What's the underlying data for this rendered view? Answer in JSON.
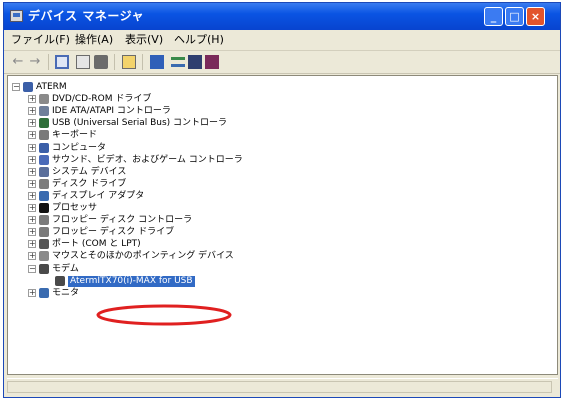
{
  "window": {
    "title": "デバイス マネージャ"
  },
  "menu": [
    "ファイル(F)",
    "操作(A)",
    "表示(V)",
    "ヘルプ(H)"
  ],
  "toolbar_icons": [
    "back-arrow-icon",
    "forward-arrow-icon",
    "properties-icon",
    "scan-hardware-icon",
    "print-icon",
    "help-icon",
    "show-hidden-icon",
    "update-driver-icon",
    "disable-device-icon",
    "uninstall-device-icon"
  ],
  "tree": {
    "root": "ATERM",
    "categories": [
      {
        "label": "DVD/CD-ROM ドライブ",
        "icon": "dvd-drive-icon",
        "color": "#8a8a8a"
      },
      {
        "label": "IDE ATA/ATAPI コントローラ",
        "icon": "ide-controller-icon",
        "color": "#6f7f9a"
      },
      {
        "label": "USB (Universal Serial Bus) コントローラ",
        "icon": "usb-controller-icon",
        "color": "#2f6f3a"
      },
      {
        "label": "キーボード",
        "icon": "keyboard-icon",
        "color": "#7a7a7a"
      },
      {
        "label": "コンピュータ",
        "icon": "computer-icon",
        "color": "#3b5fa8"
      },
      {
        "label": "サウンド、ビデオ、およびゲーム コントローラ",
        "icon": "sound-icon",
        "color": "#4a6ab8"
      },
      {
        "label": "システム デバイス",
        "icon": "system-device-icon",
        "color": "#5a6e9a"
      },
      {
        "label": "ディスク ドライブ",
        "icon": "disk-drive-icon",
        "color": "#7c7c7c"
      },
      {
        "label": "ディスプレイ アダプタ",
        "icon": "display-adapter-icon",
        "color": "#3a6bb0"
      },
      {
        "label": "プロセッサ",
        "icon": "processor-icon",
        "color": "#111111"
      },
      {
        "label": "フロッピー ディスク コントローラ",
        "icon": "floppy-controller-icon",
        "color": "#7a7a7a"
      },
      {
        "label": "フロッピー ディスク ドライブ",
        "icon": "floppy-drive-icon",
        "color": "#7a7a7a"
      },
      {
        "label": "ポート (COM と LPT)",
        "icon": "port-icon",
        "color": "#555555"
      },
      {
        "label": "マウスとそのほかのポインティング デバイス",
        "icon": "mouse-icon",
        "color": "#8a8a8a"
      },
      {
        "label": "モデム",
        "icon": "modem-icon",
        "color": "#4a4a4a",
        "expanded": true,
        "children": [
          {
            "label": "AtermITX70(i)-MAX for USB",
            "icon": "modem-device-icon",
            "selected": true
          }
        ]
      },
      {
        "label": "モニタ",
        "icon": "monitor-icon",
        "color": "#3a6bb0"
      }
    ]
  },
  "colors": {
    "title_bar": "#0a54e3",
    "selection": "#316ac5",
    "highlight_circle": "#e02020"
  }
}
